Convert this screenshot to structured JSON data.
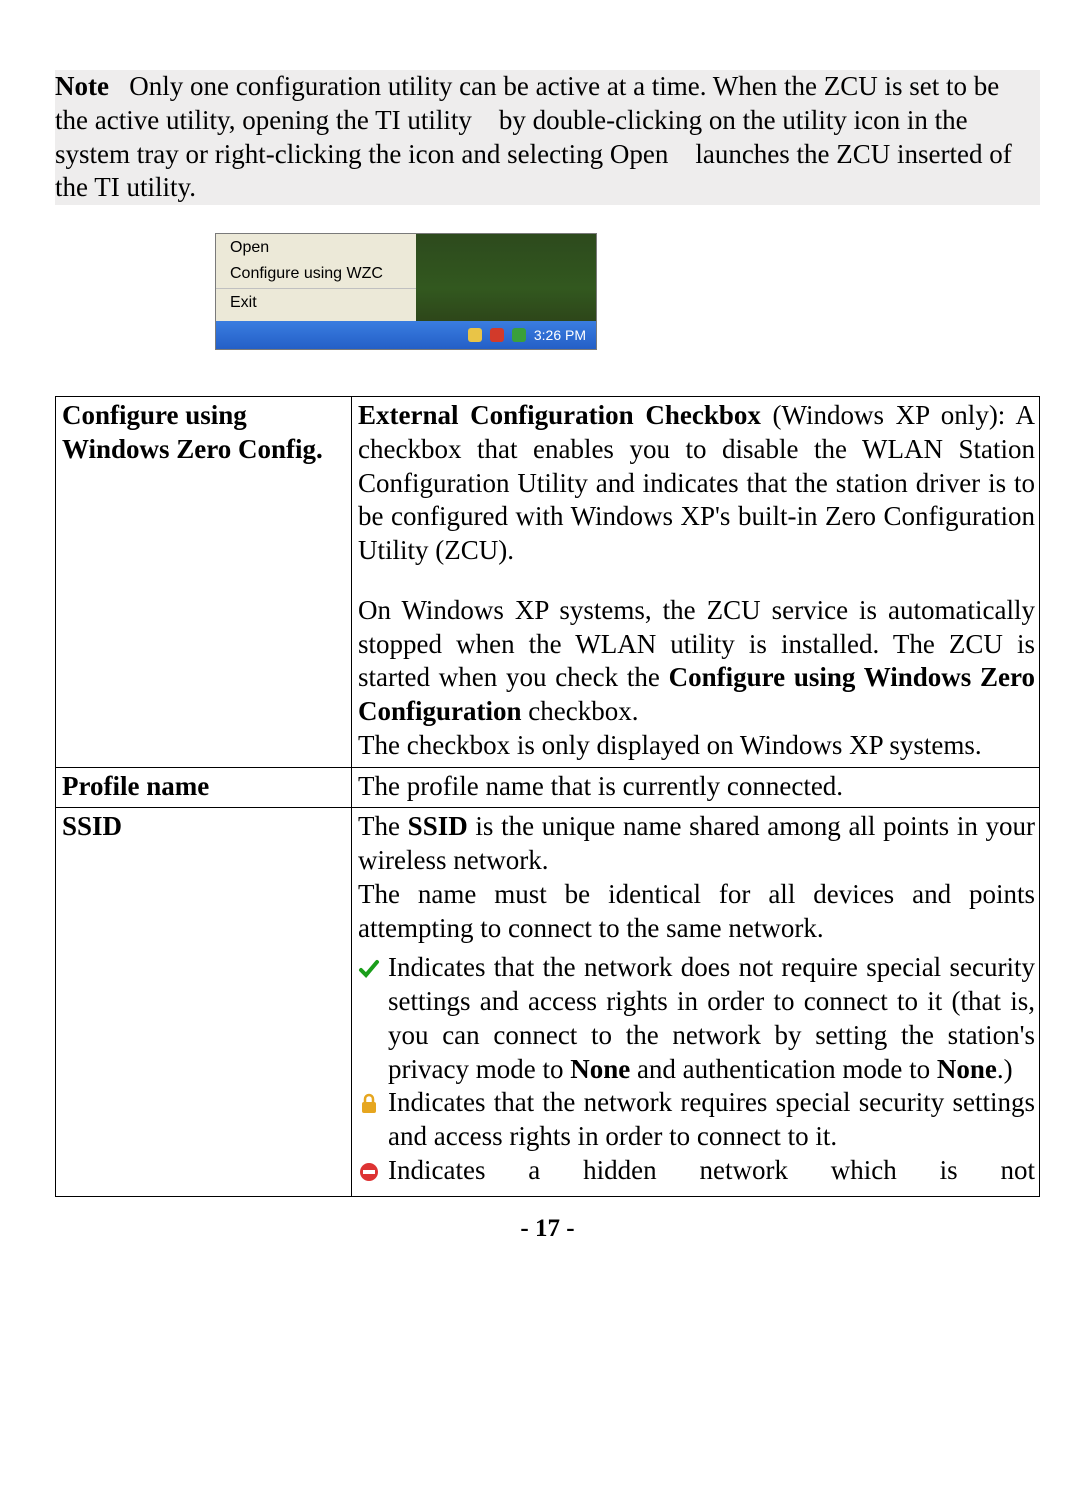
{
  "note": {
    "label": "Note",
    "body": "Only one configuration utility can be active at a time. When the ZCU is set to be the active utility, opening the TI utility by double-clicking on the utility icon in the system tray or right-clicking the icon and selecting Open launches the ZCU inserted of the TI utility."
  },
  "context_menu": {
    "open": "Open",
    "config_wzc": "Configure using WZC",
    "exit": "Exit",
    "clock": "3:26 PM"
  },
  "rows": {
    "zero_config": {
      "label": "Configure using Windows Zero Config.",
      "p1_lead": "External Configuration Checkbox",
      "p1_rest": " (Windows XP only): A checkbox that enables you to disable the WLAN Station Configuration Utility and indicates that the station driver is to be configured with Windows XP's built-in Zero Configuration Utility (ZCU).",
      "p2_a": "On Windows XP systems, the ZCU service is automatically stopped when the WLAN utility is installed. The ZCU is started when you check the ",
      "p2_bold": "Configure using Windows Zero Configuration",
      "p2_b": " checkbox.",
      "p3": "The checkbox is only displayed on Windows XP systems."
    },
    "profile": {
      "label": "Profile name",
      "desc": "The profile name that is currently connected."
    },
    "ssid": {
      "label": "SSID",
      "d1_a": "The ",
      "d1_b": "SSID",
      "d1_c": " is the unique name shared among all points in your wireless network.",
      "d2": "The name must be identical for all devices and points attempting to connect to the same network.",
      "ind1_a": "Indicates that the network does not require special security settings and access rights in order to connect to it (that is, you can connect to the network by setting the station's privacy mode to ",
      "ind1_b": "None",
      "ind1_c": " and authentication mode to ",
      "ind1_d": "None",
      "ind1_e": ".)",
      "ind2": "Indicates that the network requires special security settings and access rights in order to connect to it.",
      "ind3": "Indicates a hidden network which is not"
    }
  },
  "page_number": "- 17 -"
}
